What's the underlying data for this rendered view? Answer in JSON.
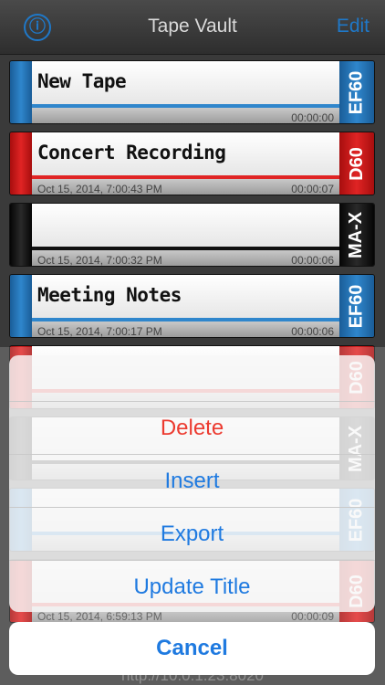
{
  "nav": {
    "title": "Tape Vault",
    "info_icon": "ⓘ",
    "edit_label": "Edit"
  },
  "tapes": [
    {
      "title": "New Tape",
      "date": "",
      "duration": "00:00:00",
      "type": "EF60",
      "color": "blue"
    },
    {
      "title": "Concert Recording",
      "date": "Oct 15, 2014, 7:00:43 PM",
      "duration": "00:00:07",
      "type": "D60",
      "color": "red"
    },
    {
      "title": "",
      "date": "Oct 15, 2014, 7:00:32 PM",
      "duration": "00:00:06",
      "type": "MA-X",
      "color": "black"
    },
    {
      "title": "Meeting Notes",
      "date": "Oct 15, 2014, 7:00:17 PM",
      "duration": "00:00:06",
      "type": "EF60",
      "color": "blue"
    },
    {
      "title": "",
      "date": "",
      "duration": "",
      "type": "D60",
      "color": "red"
    },
    {
      "title": "",
      "date": "",
      "duration": "",
      "type": "MA-X",
      "color": "black"
    },
    {
      "title": "",
      "date": "",
      "duration": "",
      "type": "EF60",
      "color": "blue"
    },
    {
      "title": "",
      "date": "Oct 15, 2014, 6:59:13 PM",
      "duration": "00:00:09",
      "type": "D60",
      "color": "red"
    }
  ],
  "action_sheet": {
    "delete": "Delete",
    "insert": "Insert",
    "export": "Export",
    "update_title": "Update Title",
    "cancel": "Cancel"
  },
  "footer_url": "http://10.0.1.23:8020",
  "colors": {
    "accent": "#1f7ae0",
    "destructive": "#ec3b30",
    "tape_blue": "#2f86cc",
    "tape_red": "#e02424",
    "tape_black": "#111111"
  }
}
